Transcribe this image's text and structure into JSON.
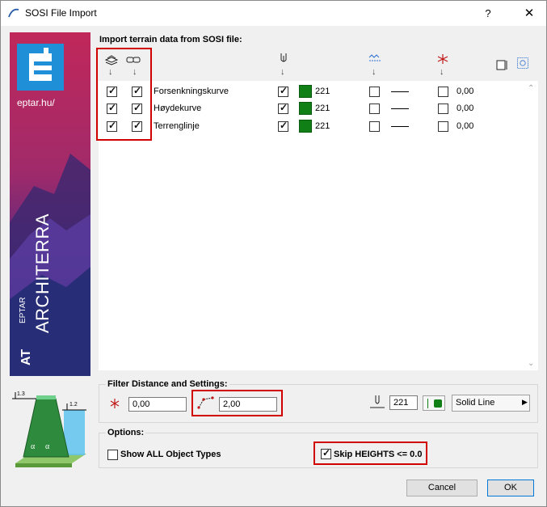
{
  "window": {
    "title": "SOSI File Import",
    "help": "?",
    "close": "✕"
  },
  "banner": {
    "url": "eptar.hu/",
    "brand_small": "EPTAR",
    "brand": "ARCHITERRA",
    "at": "AT"
  },
  "import": {
    "label": "Import terrain data from SOSI file:",
    "rows": [
      {
        "name": "Forsenkningskurve",
        "pen": "221",
        "offset": "0,00"
      },
      {
        "name": "Høydekurve",
        "pen": "221",
        "offset": "0,00"
      },
      {
        "name": "Terrenglinje",
        "pen": "221",
        "offset": "0,00"
      }
    ],
    "pen_color": "#0f7f16"
  },
  "filter": {
    "title": "Filter Distance and Settings:",
    "distance": "0,00",
    "angle": "2,00",
    "pen": "221",
    "line_type": "Solid Line"
  },
  "options": {
    "title": "Options:",
    "show_all": "Show ALL Object Types",
    "skip_heights": "Skip HEIGHTS <= 0.0"
  },
  "buttons": {
    "cancel": "Cancel",
    "ok": "OK"
  },
  "diagram": {
    "left_value": "1.3",
    "right_value": "1.2",
    "alpha": "α"
  }
}
